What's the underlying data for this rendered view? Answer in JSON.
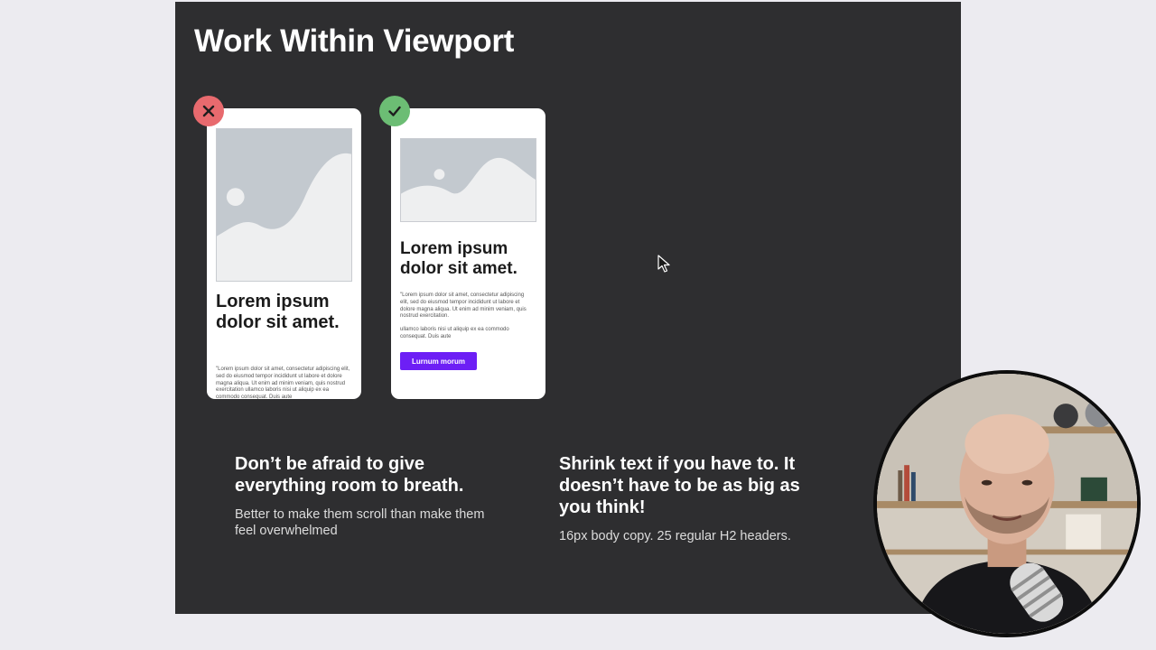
{
  "slide": {
    "title": "Work Within Viewport"
  },
  "bad_example": {
    "status_icon": "close-icon",
    "status_color": "#e86a6e",
    "heading": "Lorem ipsum dolor sit amet.",
    "body": "\"Lorem ipsum dolor sit amet, consectetur adipiscing elit, sed do eiusmod tempor incididunt ut labore et dolore magna aliqua. Ut enim ad minim veniam, quis nostrud exercitation ullamco laboris nisi ut aliquip ex ea commodo consequat. Duis aute"
  },
  "good_example": {
    "status_icon": "check-icon",
    "status_color": "#6cbd74",
    "heading": "Lorem ipsum dolor sit amet.",
    "body": "\"Lorem ipsum dolor sit amet, consectetur adipiscing elit, sed do eiusmod tempor incididunt ut labore et dolore magna aliqua. Ut enim ad minim veniam, quis nostrud exercitation.",
    "body2": "ullamco laboris nisi ut aliquip ex ea commodo consequat. Duis aute",
    "button_label": "Lurnum morum",
    "button_color": "#6d1ff5"
  },
  "captions": [
    {
      "heading": "Don’t be afraid to give everything room to breath.",
      "text": "Better to make them scroll than make them feel overwhelmed"
    },
    {
      "heading": "Shrink text if you have to. It doesn’t have to be as big as you think!",
      "text": "16px body copy. 25 regular H2 headers."
    }
  ],
  "icons": {
    "cursor": "mouse-pointer-icon",
    "image_placeholder": "image-placeholder-icon",
    "webcam": "presenter-webcam"
  },
  "colors": {
    "slide_background": "#2e2e30",
    "page_background": "#ecebf0"
  }
}
